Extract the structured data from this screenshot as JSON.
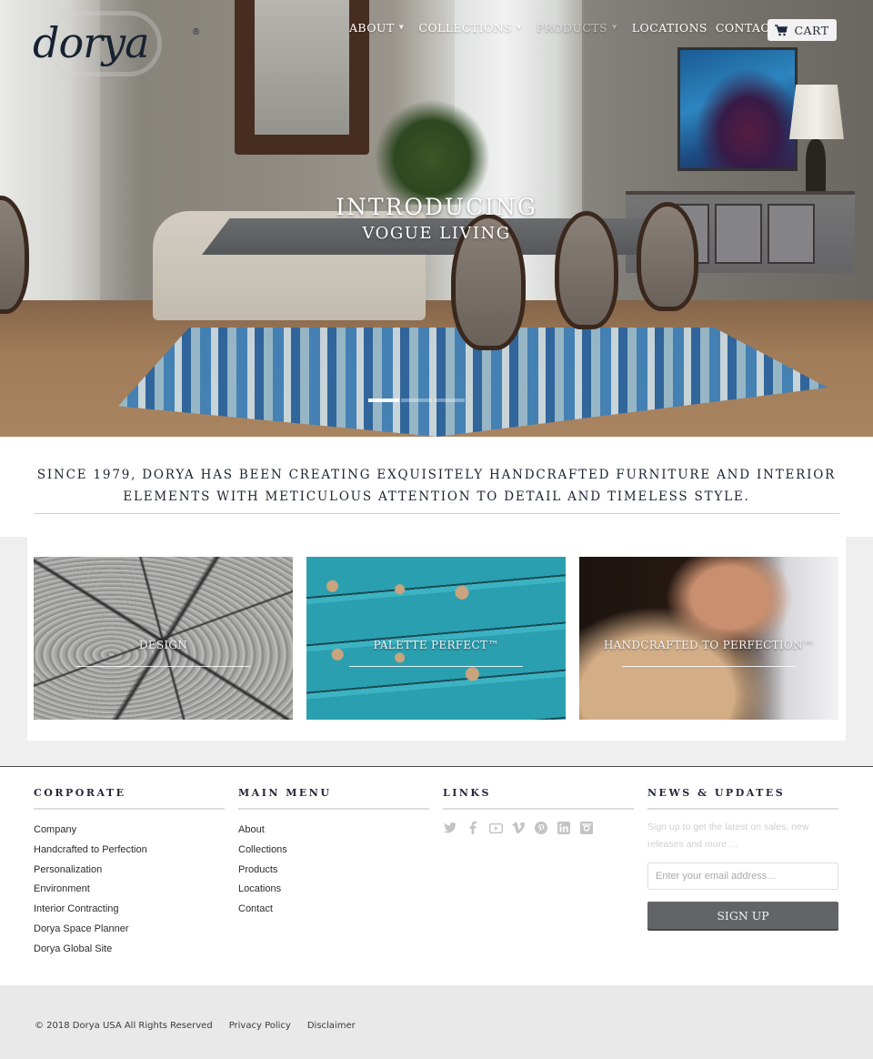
{
  "header": {
    "logo_text": "dorya",
    "logo_mark": "®",
    "nav": [
      {
        "label": "ABOUT",
        "dropdown": true
      },
      {
        "label": "COLLECTIONS",
        "dropdown": true
      },
      {
        "label": "PRODUCTS",
        "dropdown": true
      },
      {
        "label": "LOCATIONS",
        "dropdown": false
      },
      {
        "label": "CONTACT",
        "dropdown": false
      }
    ],
    "caret": "▼",
    "account_icon": "user-icon",
    "search_icon": "search-icon",
    "cart_icon": "cart-icon",
    "cart_label": "CART"
  },
  "hero": {
    "title": "INTRODUCING",
    "subtitle": "VOGUE LIVING",
    "slides_total": 3,
    "active_slide": 1
  },
  "intro": {
    "text": "SINCE 1979, DORYA HAS BEEN CREATING EXQUISITELY HANDCRAFTED FURNITURE AND INTERIOR ELEMENTS WITH METICULOUS ATTENTION TO DETAIL AND TIMELESS STYLE."
  },
  "features": [
    {
      "label": "DESIGN"
    },
    {
      "label": "PALETTE PERFECT™"
    },
    {
      "label": "HANDCRAFTED TO PERFECTION™"
    }
  ],
  "footer": {
    "corporate": {
      "heading": "CORPORATE",
      "items": [
        "Company",
        "Handcrafted to Perfection",
        "Personalization",
        "Environment",
        "Interior Contracting",
        "Dorya Space Planner",
        "Dorya Global Site"
      ]
    },
    "main_menu": {
      "heading": "MAIN MENU",
      "items": [
        "About",
        "Collections",
        "Products",
        "Locations",
        "Contact"
      ]
    },
    "links": {
      "heading": "LINKS",
      "icons": [
        "twitter-icon",
        "facebook-icon",
        "youtube-icon",
        "vimeo-icon",
        "pinterest-icon",
        "linkedin-icon",
        "instagram-icon"
      ]
    },
    "news": {
      "heading": "NEWS & UPDATES",
      "text": "Sign up to get the latest on sales, new releases and more …",
      "email_placeholder": "Enter your email address...",
      "signup_label": "SIGN UP"
    }
  },
  "bottom": {
    "copyright": "© 2018 Dorya USA All Rights Reserved",
    "privacy": "Privacy Policy",
    "disclaimer": "Disclaimer"
  },
  "colors": {
    "brand_navy": "#172230",
    "signup_button": "#636468",
    "footer_bar": "#e9e9e9"
  }
}
